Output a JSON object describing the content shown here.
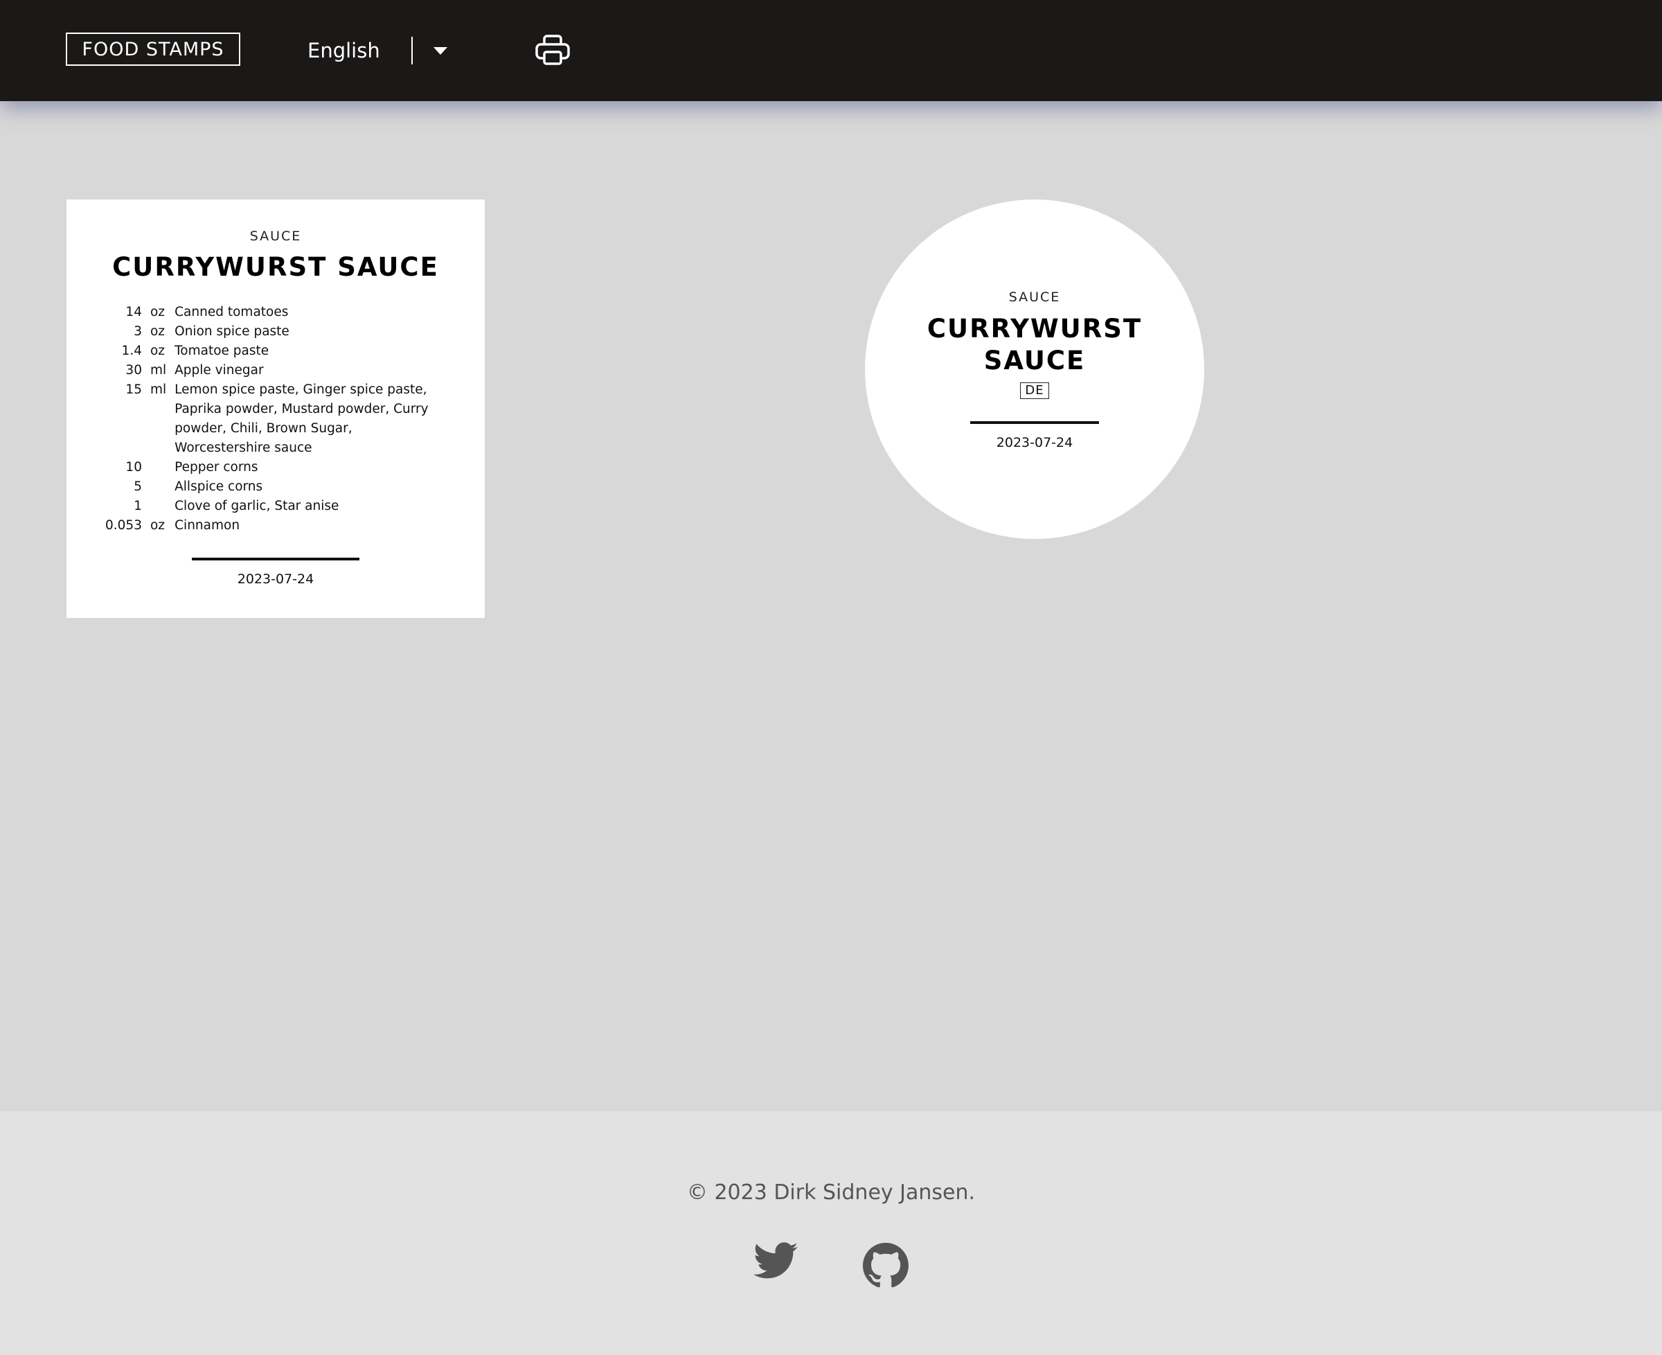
{
  "header": {
    "logo": "FOOD STAMPS",
    "language": "English",
    "icons": {
      "dropdown": "chevron-down-icon",
      "print": "printer-icon"
    }
  },
  "labels": {
    "square": {
      "category": "SAUCE",
      "title": "CURRYWURST SAUCE",
      "ingredients": [
        {
          "qty": "14",
          "unit": "oz",
          "name": "Canned tomatoes"
        },
        {
          "qty": "3",
          "unit": "oz",
          "name": "Onion spice paste"
        },
        {
          "qty": "1.4",
          "unit": "oz",
          "name": "Tomatoe paste"
        },
        {
          "qty": "30",
          "unit": "ml",
          "name": "Apple vinegar"
        },
        {
          "qty": "15",
          "unit": "ml",
          "name": "Lemon spice paste, Ginger spice paste, Paprika powder, Mustard powder, Curry powder, Chili, Brown Sugar, Worcestershire sauce"
        },
        {
          "qty": "10",
          "unit": "",
          "name": "Pepper corns"
        },
        {
          "qty": "5",
          "unit": "",
          "name": "Allspice corns"
        },
        {
          "qty": "1",
          "unit": "",
          "name": "Clove of garlic, Star anise"
        },
        {
          "qty": "0.053",
          "unit": "oz",
          "name": "Cinnamon"
        }
      ],
      "date": "2023-07-24"
    },
    "round": {
      "category": "SAUCE",
      "title_line1": "CURRYWURST",
      "title_line2": "SAUCE",
      "origin": "DE",
      "date": "2023-07-24"
    }
  },
  "footer": {
    "copyright": "© 2023 Dirk Sidney Jansen.",
    "icons": {
      "twitter": "twitter-icon",
      "github": "github-icon"
    }
  }
}
